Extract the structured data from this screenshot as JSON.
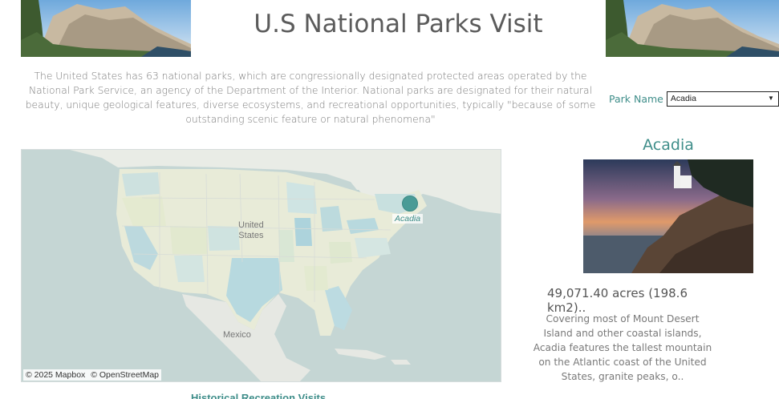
{
  "header": {
    "title": "U.S National Parks Visit",
    "intro": "The United States has 63 national parks, which are congressionally designated protected areas operated by the National Park Service, an agency of the Department of the Interior. National parks are designated for their natural beauty, unique geological features, diverse ecosystems, and recreational opportunities, typically \"because of some outstanding scenic feature or natural phenomena\""
  },
  "filter": {
    "label": "Park Name",
    "selected": "Acadia"
  },
  "map": {
    "label_country": "United States",
    "label_country_line1": "United",
    "label_country_line2": "States",
    "label_mexico": "Mexico",
    "park_marker_label": "Acadia",
    "attribution_mapbox": "© 2025 Mapbox",
    "attribution_osm": "© OpenStreetMap",
    "marker_color": "#4a9b96"
  },
  "park": {
    "name": "Acadia",
    "area": "49,071.40 acres (198.6 km2)..",
    "description": "Covering most of Mount Desert Island and other coastal islands, Acadia features the tallest mountain on the Atlantic coast of the United States, granite peaks, o.."
  },
  "section": {
    "historical_title": "Historical Recreation Visits"
  },
  "colors": {
    "accent": "#3f8e8a",
    "title": "#5b5b5b"
  }
}
